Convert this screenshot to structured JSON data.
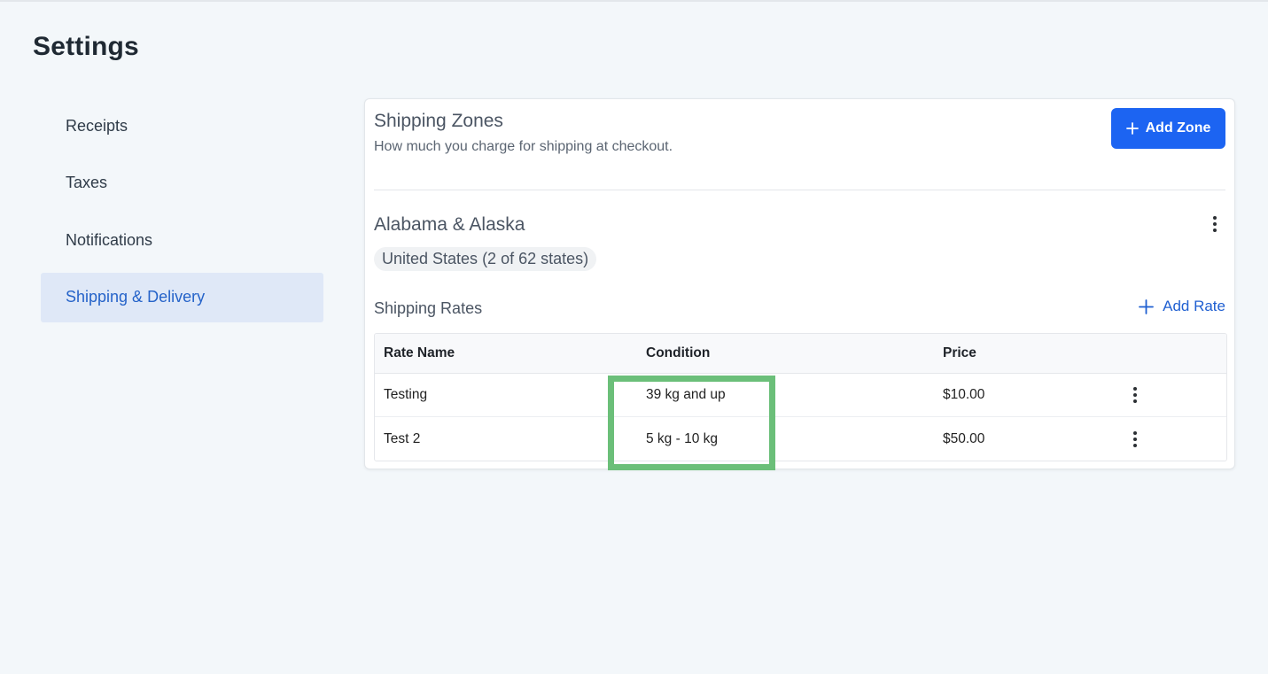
{
  "page": {
    "title": "Settings"
  },
  "sidebar": {
    "items": [
      {
        "label": "Receipts"
      },
      {
        "label": "Taxes"
      },
      {
        "label": "Notifications"
      },
      {
        "label": "Shipping & Delivery"
      }
    ]
  },
  "shipping_zones": {
    "title": "Shipping Zones",
    "subtitle": "How much you charge for shipping at checkout.",
    "add_zone_label": "Add Zone",
    "zone": {
      "name": "Alabama & Alaska",
      "region_tag": "United States (2 of 62 states)"
    },
    "rates": {
      "title": "Shipping Rates",
      "add_rate_label": "Add Rate",
      "columns": [
        "Rate Name",
        "Condition",
        "Price"
      ],
      "rows": [
        {
          "name": "Testing",
          "condition": "39 kg and up",
          "price": "$10.00"
        },
        {
          "name": "Test 2",
          "condition": "5 kg - 10 kg",
          "price": "$50.00"
        }
      ]
    }
  },
  "colors": {
    "accent": "#1c64f2",
    "active_nav_bg": "#dfe8f7",
    "highlight": "#6bbf79"
  },
  "icons": [
    "plus-icon",
    "more-vertical-icon"
  ]
}
